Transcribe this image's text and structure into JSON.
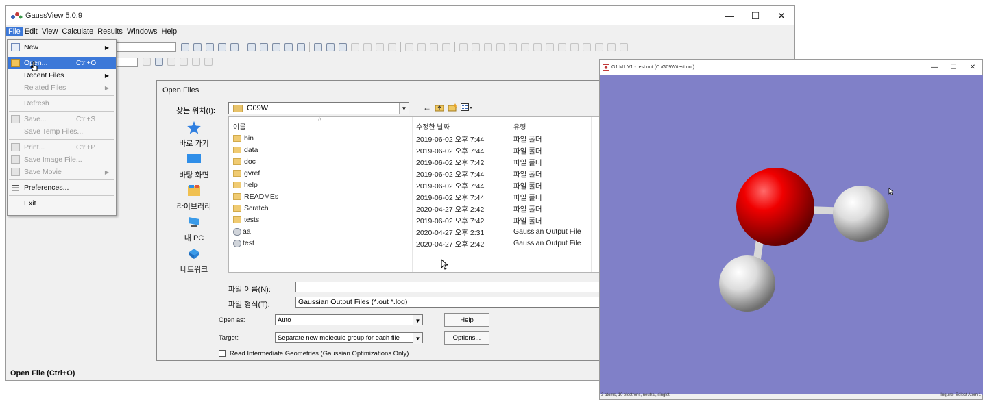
{
  "main_window": {
    "title": "GaussView 5.0.9",
    "controls": {
      "minimize": "—",
      "maximize": "☐",
      "close": "✕"
    },
    "menubar": [
      "File",
      "Edit",
      "View",
      "Calculate",
      "Results",
      "Windows",
      "Help"
    ],
    "status": "Open File (Ctrl+O)"
  },
  "file_menu": {
    "items": [
      {
        "label": "New",
        "shortcut": "",
        "arrow": "▶"
      },
      {
        "label": "Open...",
        "shortcut": "Ctrl+O",
        "arrow": ""
      },
      {
        "label": "Recent Files",
        "shortcut": "",
        "arrow": "▶"
      },
      {
        "label": "Related Files",
        "shortcut": "",
        "arrow": "▶"
      },
      {
        "label": "Refresh",
        "shortcut": "",
        "arrow": ""
      },
      {
        "label": "Save...",
        "shortcut": "Ctrl+S",
        "arrow": ""
      },
      {
        "label": "Save Temp Files...",
        "shortcut": "",
        "arrow": ""
      },
      {
        "label": "Print...",
        "shortcut": "Ctrl+P",
        "arrow": ""
      },
      {
        "label": "Save Image File...",
        "shortcut": "",
        "arrow": ""
      },
      {
        "label": "Save Movie",
        "shortcut": "",
        "arrow": "▶"
      },
      {
        "label": "Preferences...",
        "shortcut": "",
        "arrow": ""
      },
      {
        "label": "Exit",
        "shortcut": "",
        "arrow": ""
      }
    ]
  },
  "open_dialog": {
    "title": "Open Files",
    "look_in_label": "찾는 위치(I):",
    "look_in_value": "G09W",
    "places": [
      "바로 가기",
      "바탕 화면",
      "라이브러리",
      "내 PC",
      "네트워크"
    ],
    "columns": {
      "name": "이름",
      "date": "수정한 날짜",
      "type": "유형"
    },
    "files": [
      {
        "name": "bin",
        "date": "2019-06-02 오후 7:44",
        "type": "파일 폴더",
        "kind": "folder"
      },
      {
        "name": "data",
        "date": "2019-06-02 오후 7:44",
        "type": "파일 폴더",
        "kind": "folder"
      },
      {
        "name": "doc",
        "date": "2019-06-02 오후 7:42",
        "type": "파일 폴더",
        "kind": "folder"
      },
      {
        "name": "gvref",
        "date": "2019-06-02 오후 7:44",
        "type": "파일 폴더",
        "kind": "folder"
      },
      {
        "name": "help",
        "date": "2019-06-02 오후 7:44",
        "type": "파일 폴더",
        "kind": "folder"
      },
      {
        "name": "READMEs",
        "date": "2019-06-02 오후 7:44",
        "type": "파일 폴더",
        "kind": "folder"
      },
      {
        "name": "Scratch",
        "date": "2020-04-27 오후 2:42",
        "type": "파일 폴더",
        "kind": "folder"
      },
      {
        "name": "tests",
        "date": "2019-06-02 오후 7:42",
        "type": "파일 폴더",
        "kind": "folder"
      },
      {
        "name": "aa",
        "date": "2020-04-27 오후 2:31",
        "type": "Gaussian Output File",
        "kind": "output"
      },
      {
        "name": "test",
        "date": "2020-04-27 오후 2:42",
        "type": "Gaussian Output File",
        "kind": "output"
      }
    ],
    "filename_label": "파일 이름(N):",
    "filename_value": "",
    "filetype_label": "파일 형식(T):",
    "filetype_value": "Gaussian Output Files (*.out *.log)",
    "open_as_label": "Open as:",
    "open_as_value": "Auto",
    "target_label": "Target:",
    "target_value": "Separate new molecule group for each file",
    "help_button": "Help",
    "options_button": "Options...",
    "checkbox_label": "Read Intermediate Geometries (Gaussian Optimizations Only)",
    "checkbox_checked": false
  },
  "viewer": {
    "title": "G1:M1:V1 - test.out (C:/G09W/test.out)",
    "controls": {
      "minimize": "—",
      "maximize": "☐",
      "close": "✕"
    },
    "background_color": "#8080c8",
    "status_left": "3 atoms, 10 electrons, neutral, singlet",
    "status_right": "Inquire, Select Atom 1"
  }
}
